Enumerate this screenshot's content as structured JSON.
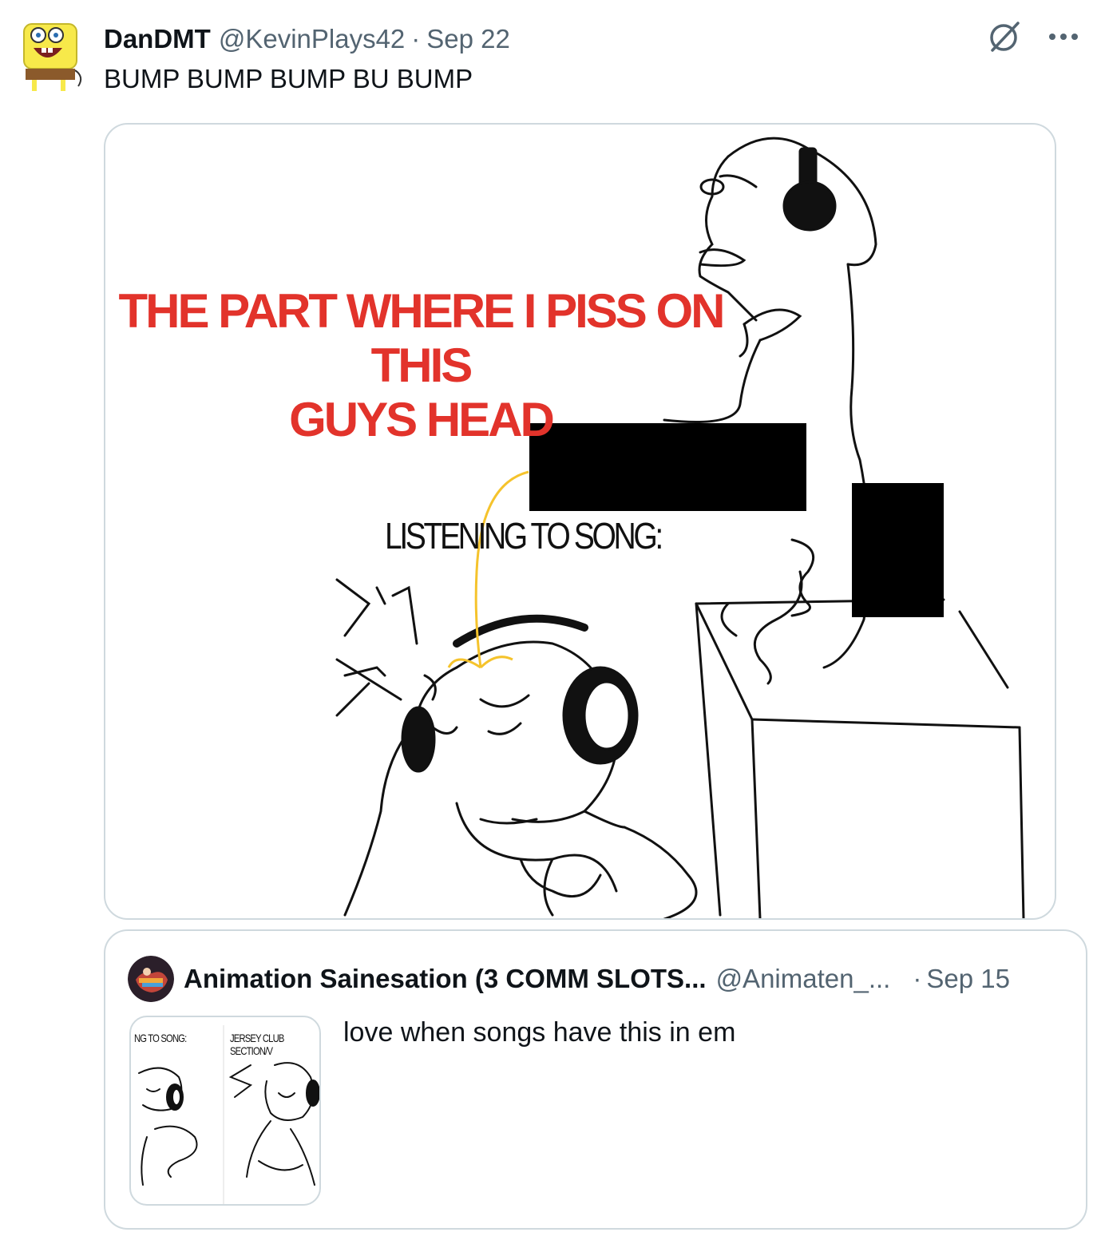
{
  "post": {
    "display_name": "DanDMT",
    "handle": "@KevinPlays42",
    "separator": "·",
    "date": "Sep 22",
    "text": "BUMP BUMP BUMP BU BUMP",
    "icons": [
      "grok-icon",
      "more-icon"
    ],
    "more_label": "···"
  },
  "media": {
    "caption_top_line1": "THE PART WHERE I PISS ON THIS",
    "caption_top_line2": "GUYS HEAD",
    "caption_listening": "LISTENING TO SONG:",
    "caption_color": "#e2332b"
  },
  "quoted": {
    "display_name": "Animation Sainesation (3 COMM SLOTS...",
    "handle": "@Animaten_...",
    "separator": "·",
    "date": "Sep 15",
    "text": "love when songs have this in em",
    "thumb_label_left": "NG TO SONG:",
    "thumb_label_right": "JERSEY CLUB SECTION/V"
  },
  "colors": {
    "text_primary": "#0f1419",
    "text_secondary": "#536471",
    "border": "#cfd9de"
  }
}
